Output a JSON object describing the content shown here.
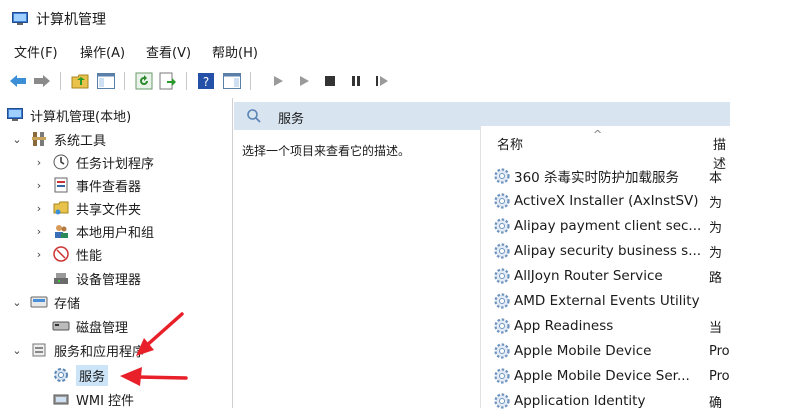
{
  "window": {
    "title": "计算机管理"
  },
  "menu": [
    "文件(F)",
    "操作(A)",
    "查看(V)",
    "帮助(H)"
  ],
  "tree": {
    "root": "计算机管理(本地)",
    "system_tools": "系统工具",
    "task_scheduler": "任务计划程序",
    "event_viewer": "事件查看器",
    "shared_folders": "共享文件夹",
    "local_users": "本地用户和组",
    "performance": "性能",
    "device_manager": "设备管理器",
    "storage": "存储",
    "disk_management": "磁盘管理",
    "services_apps": "服务和应用程序",
    "services": "服务",
    "wmi": "WMI 控件"
  },
  "services_pane": {
    "header": "服务",
    "description": "选择一个项目来查看它的描述。",
    "col_name": "名称",
    "col_desc": "描述",
    "rows": [
      {
        "name": "360 杀毒实时防护加载服务",
        "desc": "本"
      },
      {
        "name": "ActiveX Installer (AxInstSV)",
        "desc": "为"
      },
      {
        "name": "Alipay payment client sec...",
        "desc": "为"
      },
      {
        "name": "Alipay security business s...",
        "desc": "为"
      },
      {
        "name": "AllJoyn Router Service",
        "desc": "路"
      },
      {
        "name": "AMD External Events Utility",
        "desc": ""
      },
      {
        "name": "App Readiness",
        "desc": "当"
      },
      {
        "name": "Apple Mobile Device",
        "desc": "Pro"
      },
      {
        "name": "Apple Mobile Device Ser...",
        "desc": "Pro"
      },
      {
        "name": "Application Identity",
        "desc": "确"
      }
    ]
  },
  "colors": {
    "accent": "#1e78c8",
    "annotation_arrow": "#e8202a",
    "header_band": "#d9e4f1"
  }
}
